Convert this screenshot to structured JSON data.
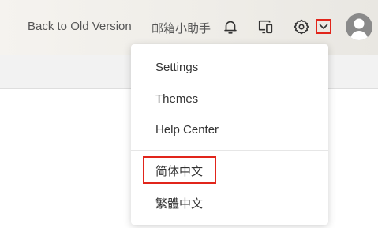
{
  "header": {
    "back_link": "Back to Old Version",
    "mail_assistant": "邮箱小助手",
    "icons": {
      "notifications": "bell-icon",
      "devices": "devices-icon",
      "settings": "gear-icon",
      "dropdown": "chevron-down-icon",
      "avatar": "user-avatar-icon"
    },
    "highlight_color": "#e1251b"
  },
  "settings_menu": {
    "items": [
      {
        "label": "Settings"
      },
      {
        "label": "Themes"
      },
      {
        "label": "Help Center"
      }
    ],
    "languages": [
      {
        "label": "简体中文",
        "highlighted": true
      },
      {
        "label": "繁體中文",
        "highlighted": false
      }
    ]
  }
}
